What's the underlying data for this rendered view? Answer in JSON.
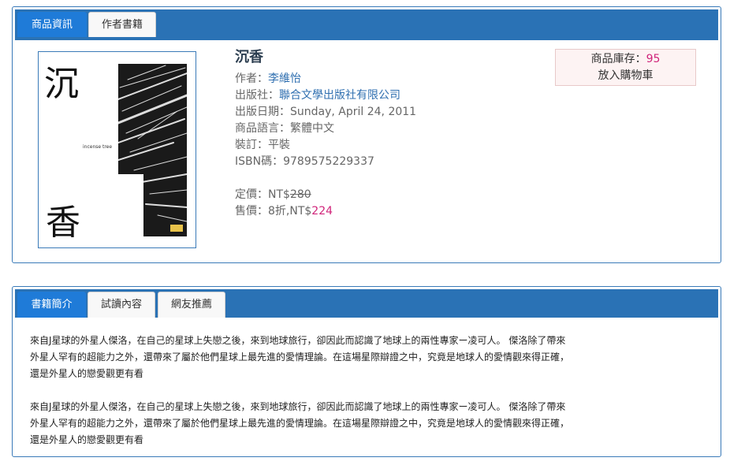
{
  "product_tabs": [
    "商品資訊",
    "作者書籍"
  ],
  "book": {
    "title": "沉香",
    "author_label": "作者：",
    "author": "李維怡",
    "publisher_label": "出版社：",
    "publisher": "聯合文學出版社有限公司",
    "date_label": "出版日期：",
    "date": "Sunday, April 24, 2011",
    "language_label": "商品語言：",
    "language": "繁體中文",
    "binding_label": "裝訂：",
    "binding": "平裝",
    "isbn_label": "ISBN碼：",
    "isbn": "9789575229337",
    "list_price_label": "定價：NT$",
    "list_price": "280",
    "sale_price_label": "售價：8折,NT$",
    "sale_price": "224"
  },
  "cover": {
    "char_top": "沉",
    "char_bottom": "香",
    "english": "incense tree"
  },
  "stock": {
    "label": "商品庫存：",
    "count": "95",
    "cart_label": "放入購物車"
  },
  "intro_tabs": [
    "書籍簡介",
    "試讀內容",
    "網友推薦"
  ],
  "intro": {
    "paragraphs": [
      "來自J星球的外星人傑洛，在自己的星球上失戀之後，來到地球旅行，卻因此而認識了地球上的兩性專家ー凌可人。 傑洛除了帶來外星人罕有的超能力之外，還帶來了屬於他們星球上最先進的愛情理論。在這場星際辯證之中，究竟是地球人的愛情觀來得正確，還是外星人的戀愛觀更有看",
      "來自J星球的外星人傑洛，在自己的星球上失戀之後，來到地球旅行，卻因此而認識了地球上的兩性專家ー凌可人。 傑洛除了帶來外星人罕有的超能力之外，還帶來了屬於他們星球上最先進的愛情理論。在這場星際辯證之中，究竟是地球人的愛情觀來得正確，還是外星人的戀愛觀更有看"
    ]
  },
  "colors": {
    "tabbar": "#2a72b5",
    "active_tab": "#1f7bd8",
    "price": "#d0247a",
    "link": "#2f6fb0"
  }
}
